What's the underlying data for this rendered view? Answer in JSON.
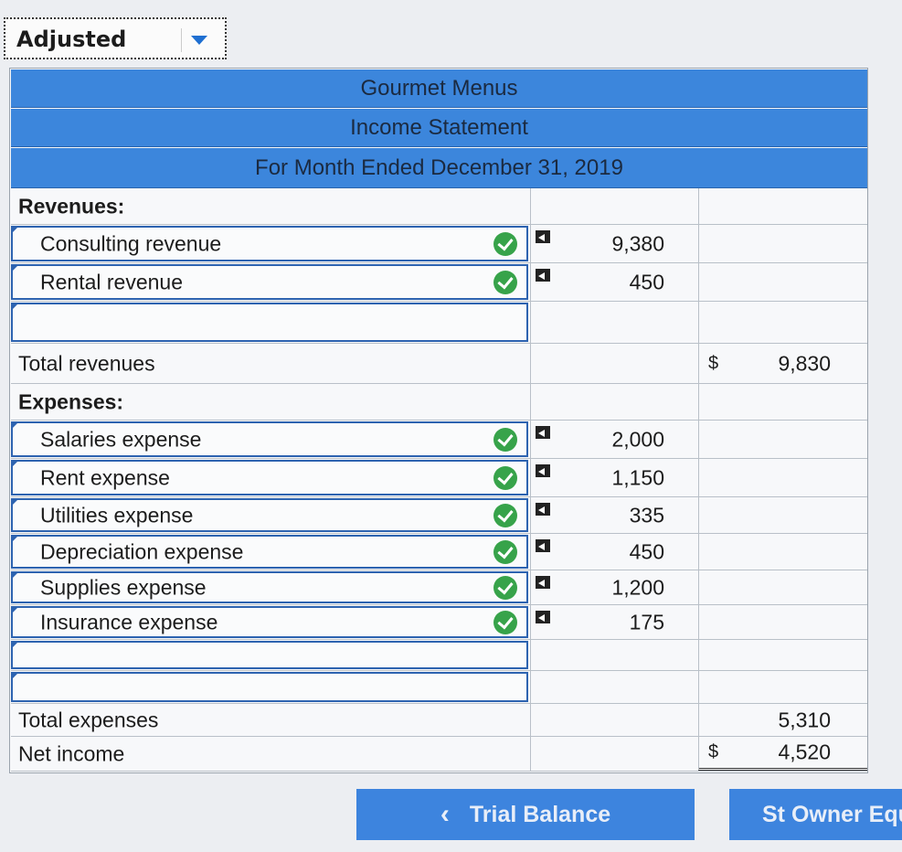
{
  "dropdown": {
    "value": "Adjusted"
  },
  "header": {
    "company": "Gourmet Menus",
    "statement": "Income Statement",
    "period": "For Month Ended December 31, 2019"
  },
  "revenues": {
    "heading": "Revenues:",
    "items": [
      {
        "label": "Consulting revenue",
        "amount": "9,380",
        "currency": "$"
      },
      {
        "label": "Rental revenue",
        "amount": "450"
      }
    ],
    "total_label": "Total revenues",
    "total_currency": "$",
    "total_amount": "9,830"
  },
  "expenses": {
    "heading": "Expenses:",
    "items": [
      {
        "label": "Salaries expense",
        "amount": "2,000"
      },
      {
        "label": "Rent expense",
        "amount": "1,150"
      },
      {
        "label": "Utilities expense",
        "amount": "335"
      },
      {
        "label": "Depreciation expense",
        "amount": "450"
      },
      {
        "label": "Supplies expense",
        "amount": "1,200"
      },
      {
        "label": "Insurance expense",
        "amount": "175"
      }
    ],
    "total_label": "Total expenses",
    "total_amount": "5,310"
  },
  "net_income": {
    "label": "Net income",
    "currency": "$",
    "amount": "4,520"
  },
  "nav": {
    "prev_label": "Trial Balance",
    "next_label": "St Owner Equ"
  },
  "colors": {
    "header_blue": "#3c86dc",
    "check_green": "#37a34a",
    "input_border": "#2d63b0"
  }
}
